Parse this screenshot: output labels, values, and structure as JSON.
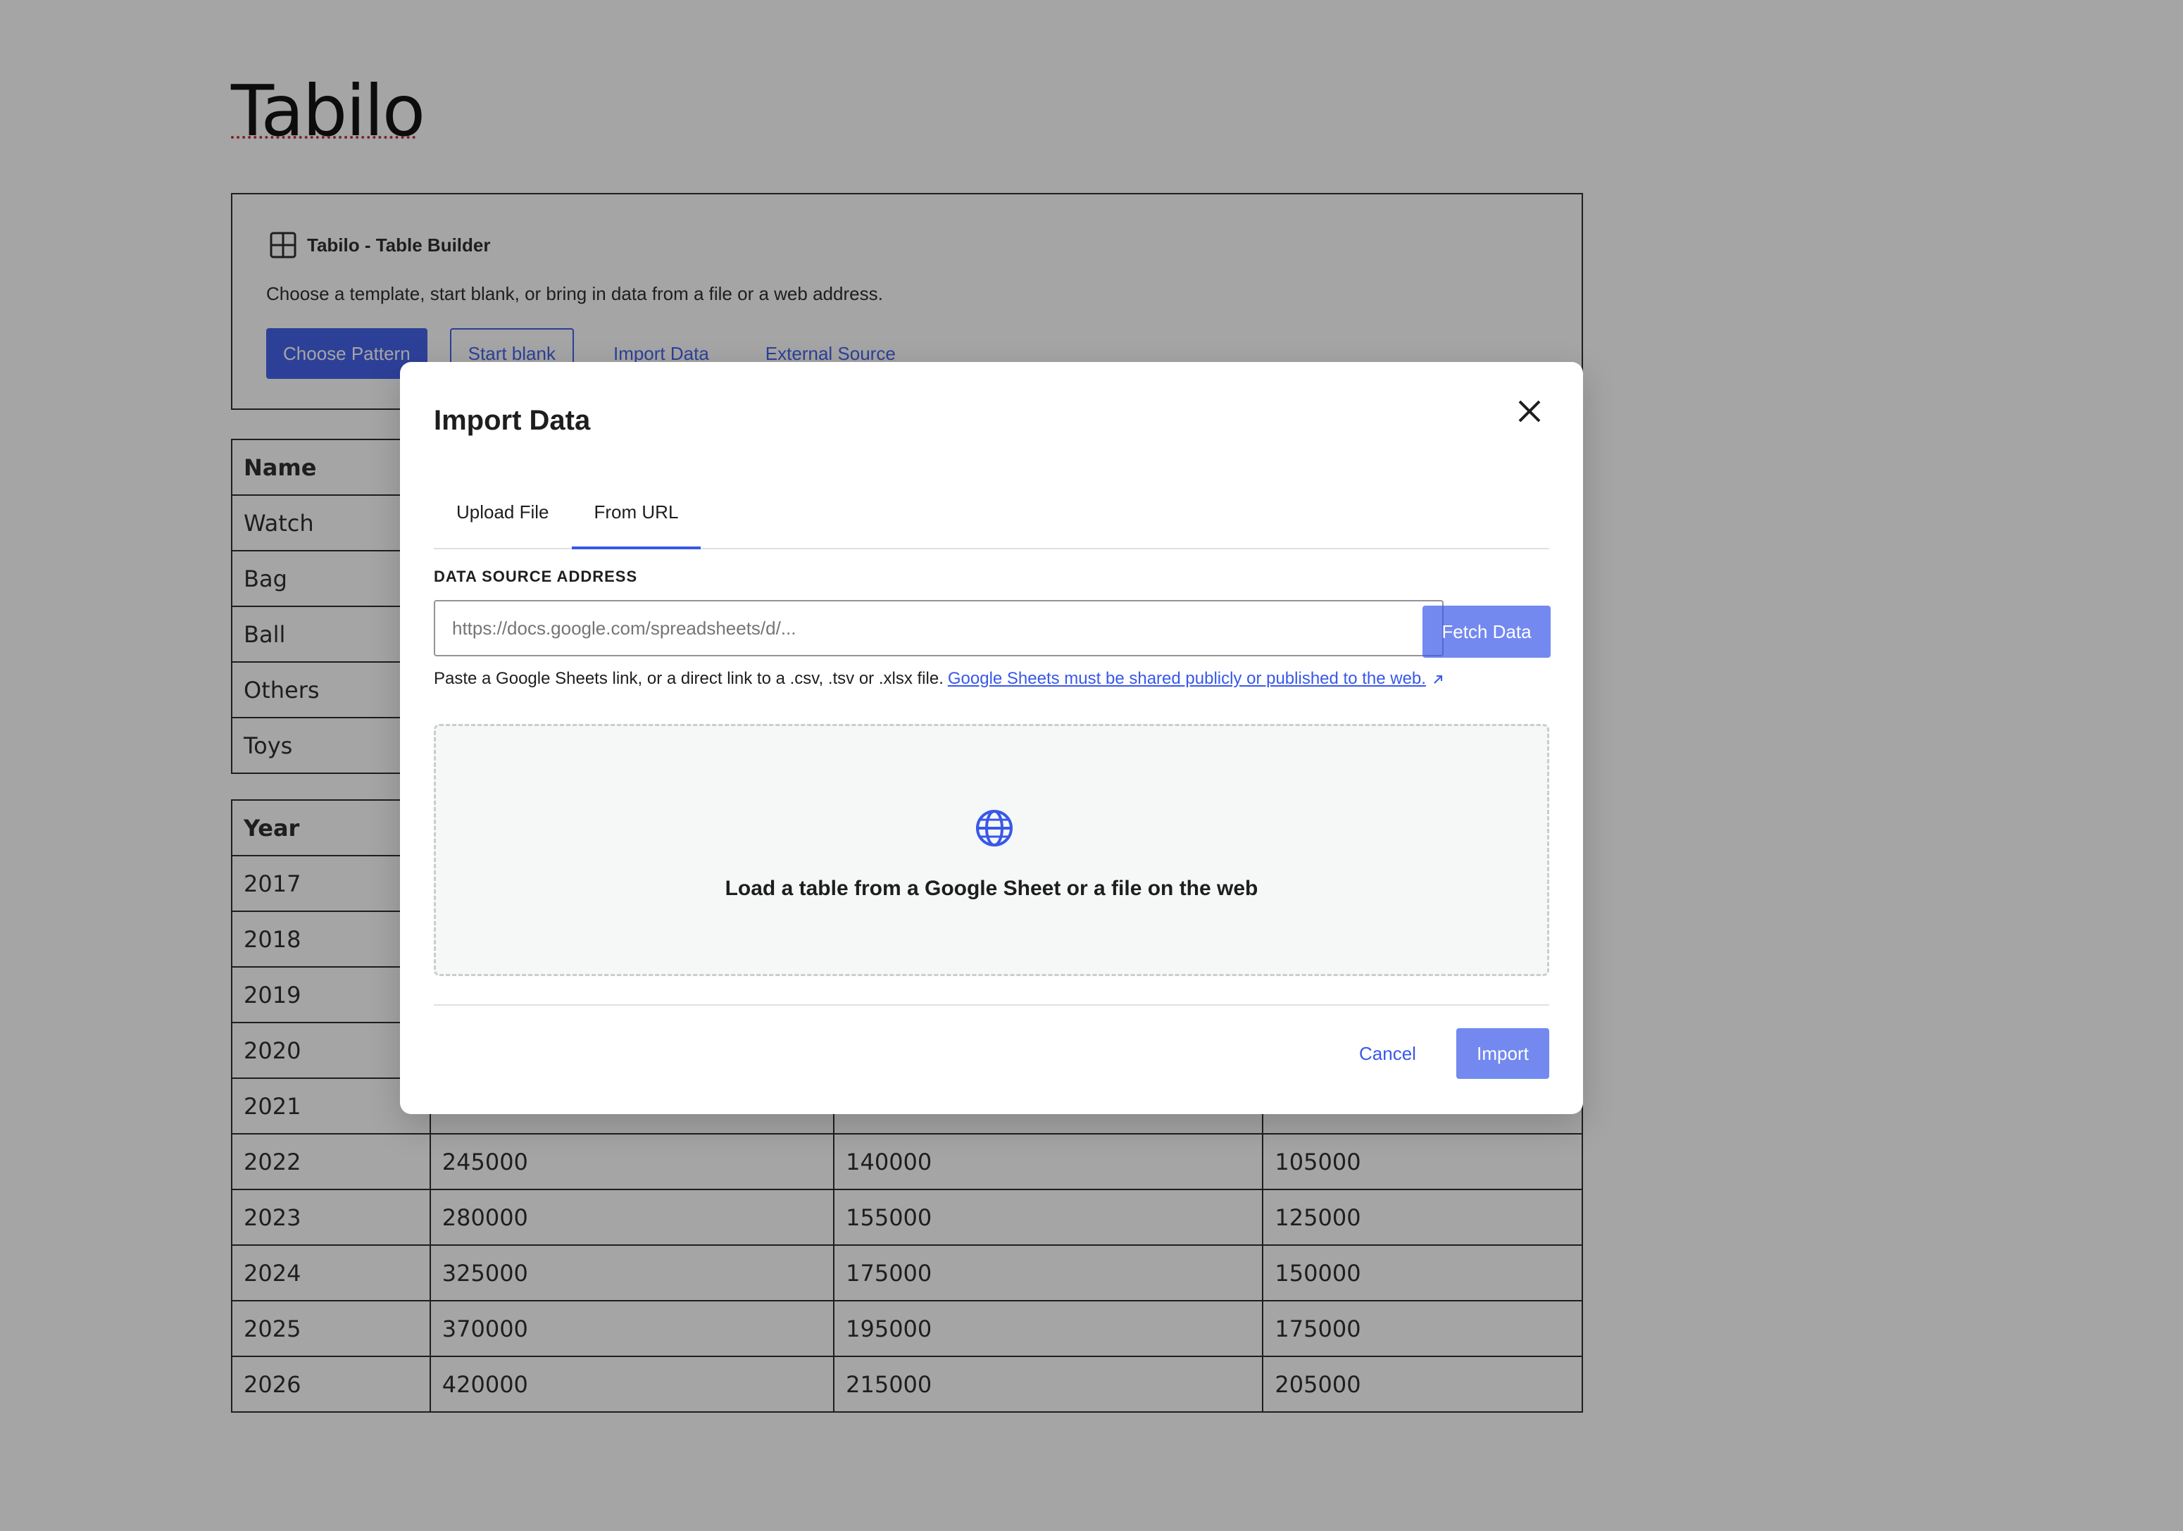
{
  "site": {
    "title": "Tabilo"
  },
  "placeholder": {
    "label": "Tabilo - Table Builder",
    "icon": "table-grid-icon",
    "instructions": "Choose a template, start blank, or bring in data from a file or a web address.",
    "buttons": {
      "choose_pattern": "Choose Pattern",
      "start_blank": "Start blank",
      "import_data": "Import Data",
      "external_source": "External Source"
    }
  },
  "table1": {
    "header": "Name",
    "rows": [
      "Watch",
      "Bag",
      "Ball",
      "Others",
      "Toys"
    ]
  },
  "table2": {
    "header": "Year",
    "rows": [
      [
        "2017",
        "",
        "",
        ""
      ],
      [
        "2018",
        "",
        "",
        ""
      ],
      [
        "2019",
        "",
        "",
        ""
      ],
      [
        "2020",
        "",
        "",
        ""
      ],
      [
        "2021",
        "",
        "",
        ""
      ],
      [
        "2022",
        "245000",
        "140000",
        "105000"
      ],
      [
        "2023",
        "280000",
        "155000",
        "125000"
      ],
      [
        "2024",
        "325000",
        "175000",
        "150000"
      ],
      [
        "2025",
        "370000",
        "195000",
        "175000"
      ],
      [
        "2026",
        "420000",
        "215000",
        "205000"
      ]
    ]
  },
  "modal": {
    "title": "Import Data",
    "close_icon": "close-icon",
    "tabs": [
      "Upload File",
      "From URL"
    ],
    "active_tab": "From URL",
    "field_label": "DATA SOURCE ADDRESS",
    "url_placeholder": "https://docs.google.com/spreadsheets/d/...",
    "url_value": "",
    "fetch_label": "Fetch Data",
    "help_text": "Paste a Google Sheets link, or a direct link to a .csv, .tsv or .xlsx file.",
    "help_link": "Google Sheets must be shared publicly or published to the web.",
    "dropzone_icon": "globe-icon",
    "dropzone_text": "Load a table from a Google Sheet or a file on the web",
    "cancel_label": "Cancel",
    "import_label": "Import"
  },
  "colors": {
    "accent": "#3858e9",
    "overlay": "#1e1e1e",
    "text": "#1e1e1e"
  }
}
